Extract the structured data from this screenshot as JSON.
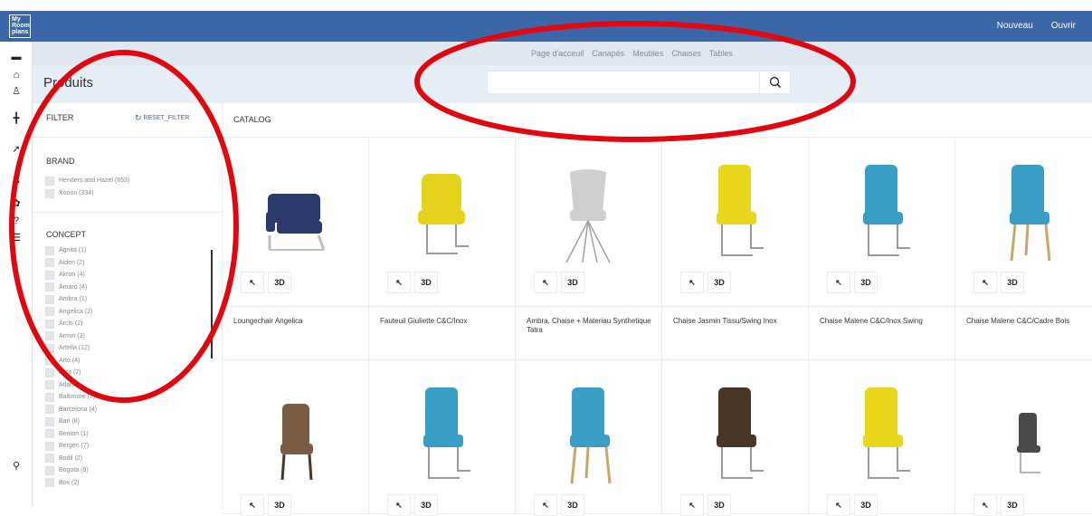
{
  "app": {
    "logo_text": "My Room plans"
  },
  "topbar": {
    "new_label": "Nouveau",
    "open_label": "Ouvrir"
  },
  "nav": {
    "links": [
      "Page d'acceuil",
      "Canapés",
      "Meubles",
      "Chaises",
      "Tables"
    ]
  },
  "page": {
    "title": "Produits"
  },
  "search": {
    "placeholder": "",
    "value": ""
  },
  "filter": {
    "title": "FILTER",
    "reset_label": "RESET_FILTER",
    "brand_title": "BRAND",
    "brands": [
      "Henders and Hazel (653)",
      "Xooon (334)"
    ],
    "concept_title": "CONCEPT",
    "concepts": [
      "Agnita (1)",
      "Aiden (2)",
      "Akron (4)",
      "Amaro (4)",
      "Ambra (1)",
      "Angelica (2)",
      "Archi (2)",
      "Armin (3)",
      "Artella (12)",
      "Arto (4)",
      "Asta (2)",
      "Atlanta",
      "Baltimore (7)",
      "Barcelona (4)",
      "Bari (8)",
      "Benton (1)",
      "Bergen (7)",
      "Bodil (2)",
      "Bogota (8)",
      "Box (2)"
    ]
  },
  "catalog": {
    "title": "CATALOG",
    "three_d_label": "3D",
    "row1": [
      {
        "name": "Loungechair Angelica",
        "color": "#2b3a6b",
        "legs": "#bdbdbd"
      },
      {
        "name": "Fauteuil Giuliette C&C/Inox",
        "color": "#e4d21c",
        "legs": "#9a9a9a"
      },
      {
        "name": "Ambra, Chaise + Materiau Synthetique Tatra",
        "color": "#cfcfcf",
        "legs": "#a0a0a0"
      },
      {
        "name": "Chaise Jasmin Tissu/Swing Inox",
        "color": "#e8d71c",
        "legs": "#9a9a9a"
      },
      {
        "name": "Chaise Malene C&C/Inox Swing",
        "color": "#3a9fc6",
        "legs": "#9a9a9a"
      },
      {
        "name": "Chaise Malene C&C/Cadre Bois",
        "color": "#3a9fc6",
        "legs": "#c8a66a"
      }
    ],
    "row2": [
      {
        "color": "#7a5b44",
        "legs": "#4a3626"
      },
      {
        "color": "#3a9fc6",
        "legs": "#9a9a9a"
      },
      {
        "color": "#3a9fc6",
        "legs": "#c8a66a"
      },
      {
        "color": "#4a3626",
        "legs": "#9a9a9a"
      },
      {
        "color": "#e8d71c",
        "legs": "#9a9a9a"
      },
      {
        "color": "#4a4a4a",
        "legs": "#9a9a9a"
      }
    ]
  },
  "annotation_color": "#e0070f"
}
